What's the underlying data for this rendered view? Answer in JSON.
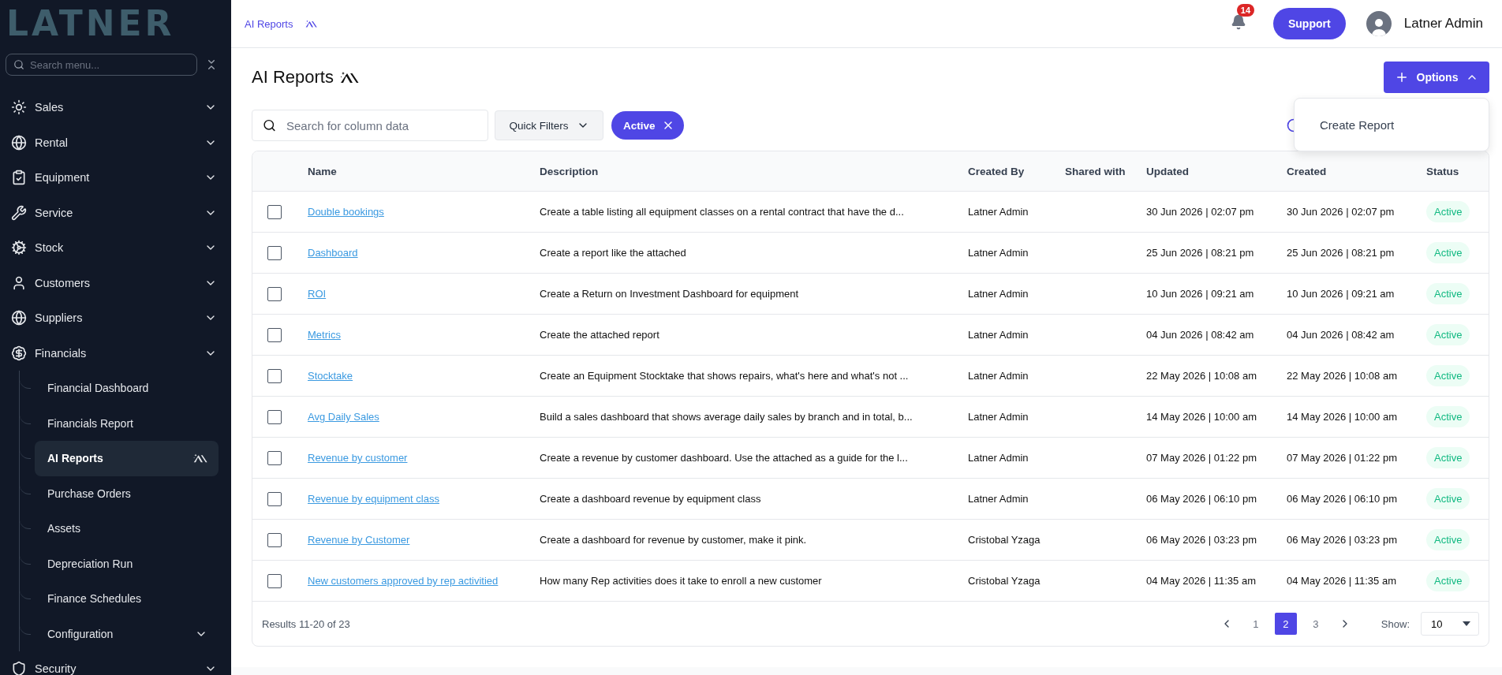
{
  "brand": {
    "logo": "LATNER"
  },
  "sidebar": {
    "search_placeholder": "Search menu...",
    "items": [
      {
        "label": "Sales"
      },
      {
        "label": "Rental"
      },
      {
        "label": "Equipment"
      },
      {
        "label": "Service"
      },
      {
        "label": "Stock"
      },
      {
        "label": "Customers"
      },
      {
        "label": "Suppliers"
      },
      {
        "label": "Financials",
        "children": [
          {
            "label": "Financial Dashboard",
            "selected": false,
            "expandable": false,
            "ai": false
          },
          {
            "label": "Financials Report",
            "selected": false,
            "expandable": false,
            "ai": false
          },
          {
            "label": "AI Reports",
            "selected": true,
            "expandable": false,
            "ai": true
          },
          {
            "label": "Purchase Orders",
            "selected": false,
            "expandable": false,
            "ai": false
          },
          {
            "label": "Assets",
            "selected": false,
            "expandable": false,
            "ai": false
          },
          {
            "label": "Depreciation Run",
            "selected": false,
            "expandable": false,
            "ai": false
          },
          {
            "label": "Finance Schedules",
            "selected": false,
            "expandable": false,
            "ai": false
          },
          {
            "label": "Configuration",
            "selected": false,
            "expandable": true,
            "ai": false
          }
        ]
      },
      {
        "label": "Security"
      }
    ]
  },
  "header": {
    "breadcrumb": "AI Reports",
    "notifications": "14",
    "support": "Support",
    "user": "Latner Admin"
  },
  "page": {
    "title": "AI Reports",
    "options": {
      "label": "Options",
      "open": true,
      "menu": [
        "Create Report"
      ]
    },
    "search_placeholder": "Search for column data",
    "quick_filters": "Quick Filters",
    "filter_chip": "Active"
  },
  "table": {
    "columns": [
      "Name",
      "Description",
      "Created By",
      "Shared with",
      "Updated",
      "Created",
      "Status"
    ],
    "rows": [
      {
        "checked": false,
        "name": "Double bookings",
        "description": "Create a table listing all equipment classes on a rental contract that have the d...",
        "created_by": "Latner Admin",
        "updated": "30 Jun 2026 | 02:07 pm",
        "created": "30 Jun 2026 | 02:07 pm",
        "status": "Active"
      },
      {
        "checked": false,
        "name": "Dashboard",
        "description": "Create a report like the attached",
        "created_by": "Latner Admin",
        "updated": "25 Jun 2026 | 08:21 pm",
        "created": "25 Jun 2026 | 08:21 pm",
        "status": "Active"
      },
      {
        "checked": false,
        "name": "ROI",
        "description": "Create a Return on Investment Dashboard for equipment",
        "created_by": "Latner Admin",
        "updated": "10 Jun 2026 | 09:21 am",
        "created": "10 Jun 2026 | 09:21 am",
        "status": "Active"
      },
      {
        "checked": false,
        "name": "Metrics",
        "description": "Create the attached report",
        "created_by": "Latner Admin",
        "updated": "04 Jun 2026 | 08:42 am",
        "created": "04 Jun 2026 | 08:42 am",
        "status": "Active"
      },
      {
        "checked": false,
        "name": "Stocktake",
        "description": "Create an Equipment Stocktake that shows repairs, what's here and what's not ...",
        "created_by": "Latner Admin",
        "updated": "22 May 2026 | 10:08 am",
        "created": "22 May 2026 | 10:08 am",
        "status": "Active"
      },
      {
        "checked": false,
        "name": "Avg Daily Sales",
        "description": "Build a sales dashboard that shows average daily sales by branch and in total, b...",
        "created_by": "Latner Admin",
        "updated": "14 May 2026 | 10:00 am",
        "created": "14 May 2026 | 10:00 am",
        "status": "Active"
      },
      {
        "checked": false,
        "name": "Revenue by customer",
        "description": "Create a revenue by customer dashboard. Use the attached as a guide for the l...",
        "created_by": "Latner Admin",
        "updated": "07 May 2026 | 01:22 pm",
        "created": "07 May 2026 | 01:22 pm",
        "status": "Active"
      },
      {
        "checked": false,
        "name": "Revenue by equipment class",
        "description": "Create a dashboard revenue by equipment class",
        "created_by": "Latner Admin",
        "updated": "06 May 2026 | 06:10 pm",
        "created": "06 May 2026 | 06:10 pm",
        "status": "Active"
      },
      {
        "checked": false,
        "name": "Revenue by Customer",
        "description": "Create a dashboard for revenue by customer, make it pink.",
        "created_by": "Cristobal Yzaga",
        "updated": "06 May 2026 | 03:23 pm",
        "created": "06 May 2026 | 03:23 pm",
        "status": "Active"
      },
      {
        "checked": false,
        "name": "New customers approved by rep activitied",
        "description": "How many Rep activities does it take to enroll a new customer",
        "created_by": "Cristobal Yzaga",
        "updated": "04 May 2026 | 11:35 am",
        "created": "04 May 2026 | 11:35 am",
        "status": "Active"
      }
    ],
    "footer": {
      "results": "Results 11-20 of 23",
      "pages": [
        {
          "label": "1",
          "selected": false
        },
        {
          "label": "2",
          "selected": true
        },
        {
          "label": "3",
          "selected": false
        }
      ],
      "show_label": "Show:",
      "page_size": "10"
    }
  }
}
